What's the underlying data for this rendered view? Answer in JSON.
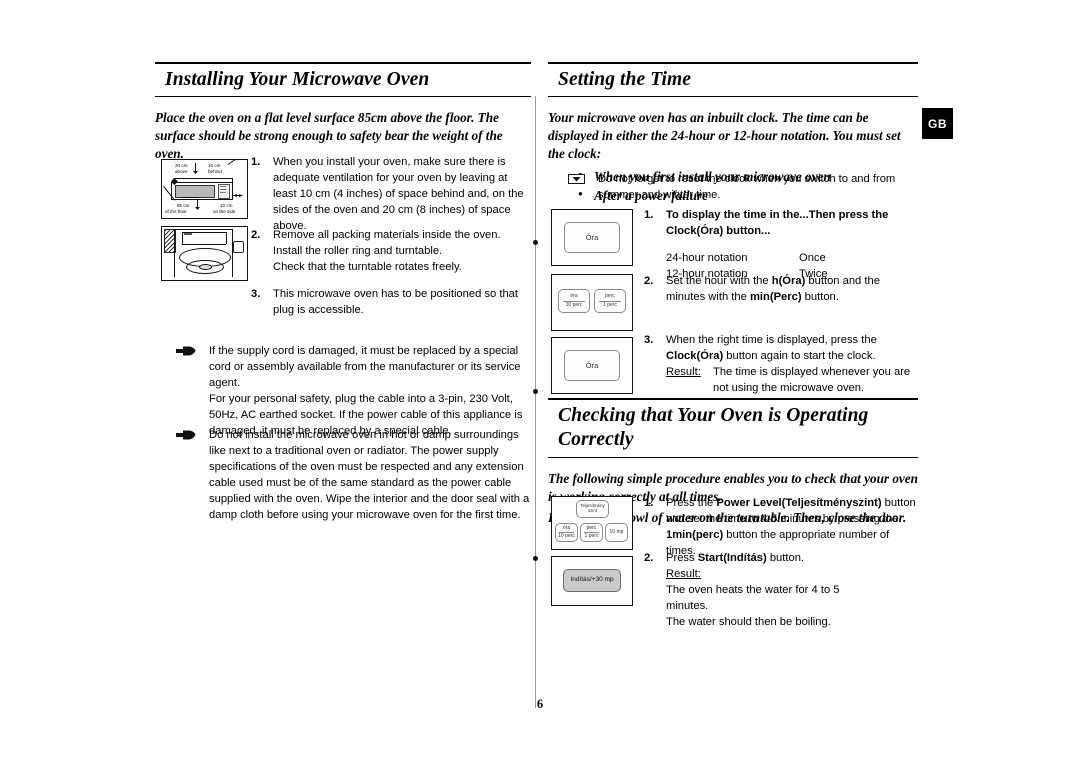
{
  "page": {
    "number": "6",
    "locale_badge": "GB"
  },
  "left_column": {
    "heading": "Installing Your Microwave Oven",
    "intro": "Place the oven on a flat level surface 85cm above the floor. The surface should be strong enough to safety bear the weight of the oven.",
    "steps": [
      {
        "num": "1.",
        "text": "When you install your oven, make sure there is adequate ventilation for your oven by leaving at least 10 cm (4 inches) of space behind and, on the sides of the oven and 20 cm (8 inches) of space above."
      },
      {
        "num": "2.",
        "text": "Remove all packing materials inside the oven.\nInstall the roller ring and turntable.\nCheck that the turntable rotates freely."
      },
      {
        "num": "3.",
        "text": "This microwave oven has to be positioned so that plug is accessible."
      }
    ],
    "notes": [
      "If the supply cord is damaged, it must be replaced by a special cord or assembly available from the manufacturer or its service agent.\nFor your personal safety, plug the cable into a 3-pin, 230 Volt, 50Hz, AC earthed socket. If the power cable of this appliance is damaged, it must be replaced by a special cable.",
      "Do not install the microwave oven in hot or damp surroundings like next to a traditional oven or radiator. The power supply specifications of the oven must be respected and any extension cable used must be of the same standard as the power cable supplied with the oven. Wipe the interior and the door seal with a damp cloth before using your microwave oven for the first time."
    ],
    "illustration_clearance": {
      "top_left": "20 cm\nabove",
      "top_right": "10 cm\nbehind",
      "bottom_left": "85 cm\nof the floor",
      "bottom_right": "10 cm\non the side"
    }
  },
  "right_column": {
    "section_time": {
      "heading": "Setting the Time",
      "intro": "Your microwave oven has an inbuilt clock. The time can be displayed in either the 24-hour or 12-hour notation. You must set the clock:",
      "bullets": [
        "When you first install your microwave oven",
        "After a power failure"
      ],
      "memo": "Do not forget to reset the clock when you switch to and from summer and winter time.",
      "steps": [
        {
          "num": "1.",
          "lead_bold": "To display the time in the...Then press the Clock(Óra) button...",
          "table": [
            {
              "label": "24-hour notation",
              "value": "Once"
            },
            {
              "label": "12-hour notation",
              "value": "Twice"
            }
          ],
          "key_labels": [
            "Óra"
          ]
        },
        {
          "num": "2.",
          "text_parts": [
            {
              "t": "Set the hour with the ",
              "b": false
            },
            {
              "t": "h(Óra)",
              "b": true
            },
            {
              "t": " button and the minutes with the ",
              "b": false
            },
            {
              "t": "min(Perc)",
              "b": true
            },
            {
              "t": " button.",
              "b": false
            }
          ],
          "key_labels": [
            "óra / 10 perc",
            "perc / 1 perc"
          ]
        },
        {
          "num": "3.",
          "text_parts": [
            {
              "t": "When the right time is displayed, press the ",
              "b": false
            },
            {
              "t": "Clock(Óra)",
              "b": true
            },
            {
              "t": " button again to start the clock.",
              "b": false
            }
          ],
          "result_label": "Result:",
          "result_text": "The time is displayed whenever you are not using the microwave oven.",
          "key_labels": [
            "Óra"
          ]
        }
      ]
    },
    "section_check": {
      "heading": "Checking that Your Oven is Operating Correctly",
      "intro_1": "The following simple procedure enables you to check that your oven is working correctly at all times.",
      "intro_2": "First, place a bowl of water on the turntable. Then, close the door.",
      "steps": [
        {
          "num": "1.",
          "text_parts": [
            {
              "t": "Press the ",
              "b": false
            },
            {
              "t": "Power Level(Teljesítményszint)",
              "b": true
            },
            {
              "t": " button and set the time to 4-5 minutes by pressing the ",
              "b": false
            },
            {
              "t": "1min(perc)",
              "b": true
            },
            {
              "t": " button the appropriate number of times.",
              "b": false
            }
          ],
          "key_labels": [
            "Teljesítmény szint",
            "óra / 10 perc",
            "perc / 1 perc",
            "10 mp"
          ]
        },
        {
          "num": "2.",
          "text_parts": [
            {
              "t": "Press ",
              "b": false
            },
            {
              "t": "Start(Indítás)",
              "b": true
            },
            {
              "t": " button.",
              "b": false
            }
          ],
          "result_label": "Result:",
          "result_text": "The oven heats the water for 4 to 5 minutes.\nThe water should then be boiling.",
          "key_labels": [
            "Indítás/+30 mp"
          ]
        }
      ]
    }
  },
  "keys": {
    "ora": "Óra",
    "ora_top": "óra",
    "ora_bot": "10 perc",
    "perc_top": "perc",
    "perc_bot": "1 perc",
    "tizmp": "10 mp",
    "teljesitmeny_top": "Teljesítmény",
    "teljesitmeny_bot": "szint",
    "inditas": "Indítás/+30 mp"
  },
  "colors": {
    "text": "#000000",
    "badge_bg": "#000000",
    "badge_fg": "#ffffff",
    "key_shaded": "#c9c9c9",
    "divider": "#9a9a9a"
  }
}
